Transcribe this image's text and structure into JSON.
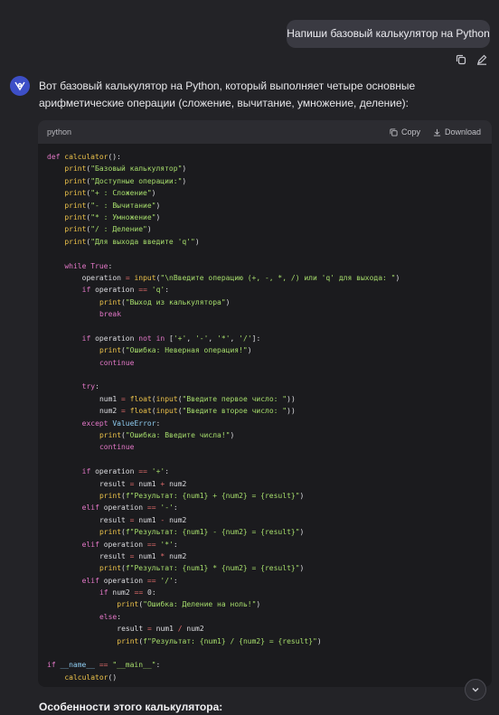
{
  "user_message": "Напиши базовый калькулятор на Python",
  "icons": {
    "copy": "copy-icon",
    "edit": "edit-icon",
    "avatar": "assistant-avatar-icon",
    "download": "download-icon",
    "scroll": "chevron-down-icon"
  },
  "colors": {
    "background": "#232327",
    "user_bubble": "#3a3a42",
    "code_background": "#1b1b1e",
    "code_header": "#2c2c31",
    "keyword": "#e377c7",
    "function": "#ecc24a",
    "string": "#a7de6c",
    "operator": "#e06b6b"
  },
  "assistant": {
    "intro": "Вот базовый калькулятор на Python, который выполняет четыре основные арифметические операции (сложение, вычитание, умножение, деление):",
    "code_block": {
      "language": "python",
      "copy_label": "Copy",
      "download_label": "Download",
      "lines": [
        "def calculator():",
        "    print(\"Базовый калькулятор\")",
        "    print(\"Доступные операции:\")",
        "    print(\"+ : Сложение\")",
        "    print(\"- : Вычитание\")",
        "    print(\"* : Умножение\")",
        "    print(\"/ : Деление\")",
        "    print(\"Для выхода введите 'q'\")",
        "",
        "    while True:",
        "        operation = input(\"\\nВведите операцию (+, -, *, /) или 'q' для выхода: \")",
        "        if operation == 'q':",
        "            print(\"Выход из калькулятора\")",
        "            break",
        "",
        "        if operation not in ['+', '-', '*', '/']:",
        "            print(\"Ошибка: Неверная операция!\")",
        "            continue",
        "",
        "        try:",
        "            num1 = float(input(\"Введите первое число: \"))",
        "            num2 = float(input(\"Введите второе число: \"))",
        "        except ValueError:",
        "            print(\"Ошибка: Введите числа!\")",
        "            continue",
        "",
        "        if operation == '+':",
        "            result = num1 + num2",
        "            print(f\"Результат: {num1} + {num2} = {result}\")",
        "        elif operation == '-':",
        "            result = num1 - num2",
        "            print(f\"Результат: {num1} - {num2} = {result}\")",
        "        elif operation == '*':",
        "            result = num1 * num2",
        "            print(f\"Результат: {num1} * {num2} = {result}\")",
        "        elif operation == '/':",
        "            if num2 == 0:",
        "                print(\"Ошибка: Деление на ноль!\")",
        "            else:",
        "                result = num1 / num2",
        "                print(f\"Результат: {num1} / {num2} = {result}\")",
        "",
        "if __name__ == \"__main__\":",
        "    calculator()"
      ]
    },
    "section_title": "Особенности этого калькулятора:"
  }
}
